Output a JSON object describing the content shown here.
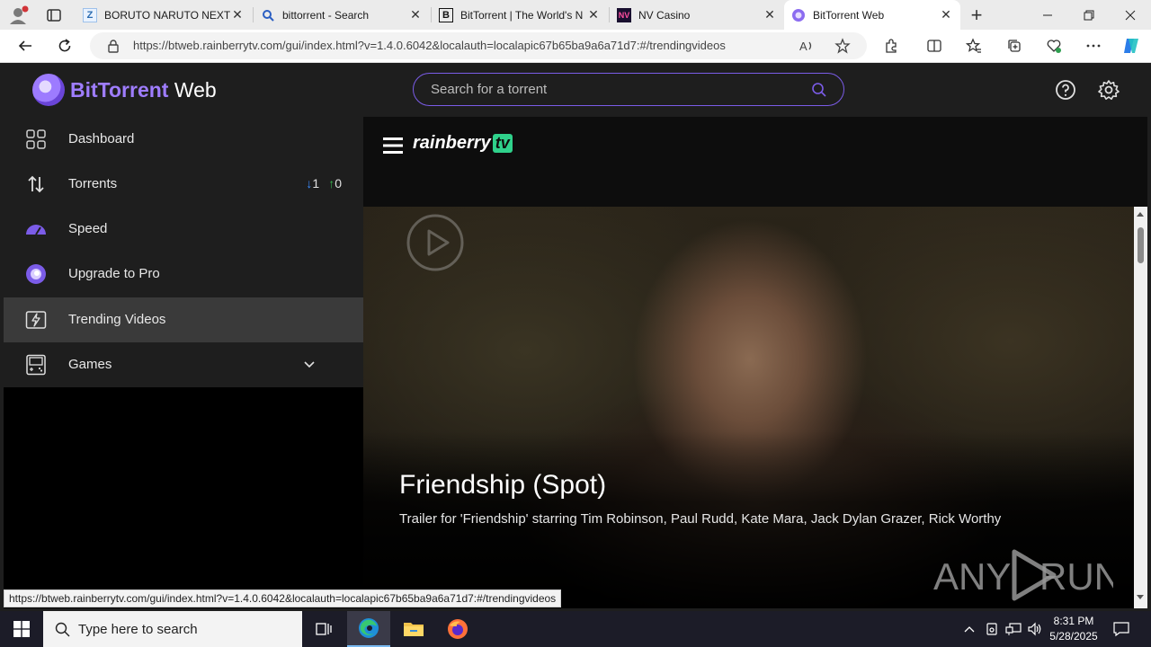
{
  "browser": {
    "tabs": [
      {
        "title": "BORUTO NARUTO NEXT G",
        "icon": "manga-site-icon"
      },
      {
        "title": "bittorrent - Search",
        "icon": "search-icon"
      },
      {
        "title": "BitTorrent | The World's N",
        "icon": "bittorrent-b-icon"
      },
      {
        "title": "NV Casino",
        "icon": "nv-casino-icon"
      },
      {
        "title": "BitTorrent Web",
        "icon": "bittorrent-web-icon"
      }
    ],
    "url": "https://btweb.rainberrytv.com/gui/index.html?v=1.4.0.6042&localauth=localapic67b65ba9a6a71d7:#/trendingvideos",
    "status_url": "https://btweb.rainberrytv.com/gui/index.html?v=1.4.0.6042&localauth=localapic67b65ba9a6a71d7:#/trendingvideos"
  },
  "app": {
    "logo_bold": "BitTorrent",
    "logo_light": " Web",
    "search_placeholder": "Search for a torrent",
    "accent": "#7b5ce8"
  },
  "sidebar": {
    "items": [
      {
        "label": "Dashboard"
      },
      {
        "label": "Torrents",
        "down_count": "1",
        "up_count": "0"
      },
      {
        "label": "Speed"
      },
      {
        "label": "Upgrade to Pro"
      },
      {
        "label": "Trending Videos"
      },
      {
        "label": "Games"
      }
    ]
  },
  "rainberry": {
    "brand": "rainberry",
    "brand_tv": "tv",
    "video_title": "Friendship (Spot)",
    "video_description": "Trailer for 'Friendship' starring Tim Robinson, Paul Rudd, Kate Mara, Jack Dylan Grazer, Rick Worthy",
    "watermark": "ANY RUN"
  },
  "taskbar": {
    "search_placeholder": "Type here to search",
    "time": "8:31 PM",
    "date": "5/28/2025"
  }
}
